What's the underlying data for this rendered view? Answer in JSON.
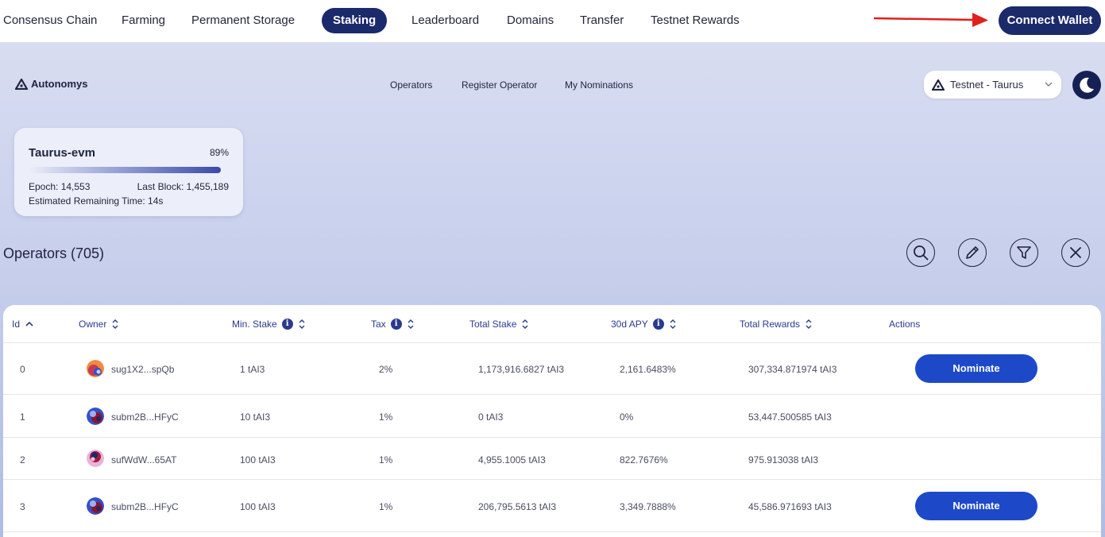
{
  "topnav": {
    "items": [
      {
        "label": "Consensus Chain"
      },
      {
        "label": "Farming"
      },
      {
        "label": "Permanent Storage"
      },
      {
        "label": "Staking"
      },
      {
        "label": "Leaderboard"
      },
      {
        "label": "Domains"
      },
      {
        "label": "Transfer"
      },
      {
        "label": "Testnet Rewards"
      }
    ],
    "active": "Staking",
    "connect_label": "Connect Wallet"
  },
  "brand": {
    "name": "Autonomys"
  },
  "subnav": {
    "items": [
      {
        "label": "Operators"
      },
      {
        "label": "Register Operator"
      },
      {
        "label": "My Nominations"
      }
    ]
  },
  "network": {
    "selected": "Testnet - Taurus"
  },
  "domain_card": {
    "name": "Taurus-evm",
    "progress_pct": "89%",
    "progress_value": 0.89,
    "epoch": "Epoch: 14,553",
    "last_block": "Last Block: 1,455,189",
    "remaining": "Estimated Remaining Time: 14s"
  },
  "operators": {
    "title": "Operators (705)",
    "columns": [
      {
        "label": "Id"
      },
      {
        "label": "Owner"
      },
      {
        "label": "Min. Stake"
      },
      {
        "label": "Tax"
      },
      {
        "label": "Total Stake"
      },
      {
        "label": "30d APY"
      },
      {
        "label": "Total Rewards"
      },
      {
        "label": "Actions"
      }
    ],
    "nominate_label": "Nominate",
    "rows": [
      {
        "id": "0",
        "owner": "sug1X2...spQb",
        "min_stake": "1 tAI3",
        "tax": "2%",
        "total_stake": "1,173,916.6827 tAI3",
        "apy": "2,161.6483%",
        "rewards": "307,334.871974 tAI3"
      },
      {
        "id": "1",
        "owner": "subm2B...HFyC",
        "min_stake": "10 tAI3",
        "tax": "1%",
        "total_stake": "0 tAI3",
        "apy": "0%",
        "rewards": "53,447.500585 tAI3"
      },
      {
        "id": "2",
        "owner": "sufWdW...65AT",
        "min_stake": "100 tAI3",
        "tax": "1%",
        "total_stake": "4,955.1005 tAI3",
        "apy": "822.7676%",
        "rewards": "975.913038 tAI3"
      },
      {
        "id": "3",
        "owner": "subm2B...HFyC",
        "min_stake": "100 tAI3",
        "tax": "1%",
        "total_stake": "206,795.5613 tAI3",
        "apy": "3,349.7888%",
        "rewards": "45,586.971693 tAI3"
      }
    ]
  },
  "colors": {
    "brand_dark": "#1b2a6b",
    "nominate": "#1d49c9",
    "header_text": "#2b3a8f",
    "arrow": "#e02020"
  }
}
